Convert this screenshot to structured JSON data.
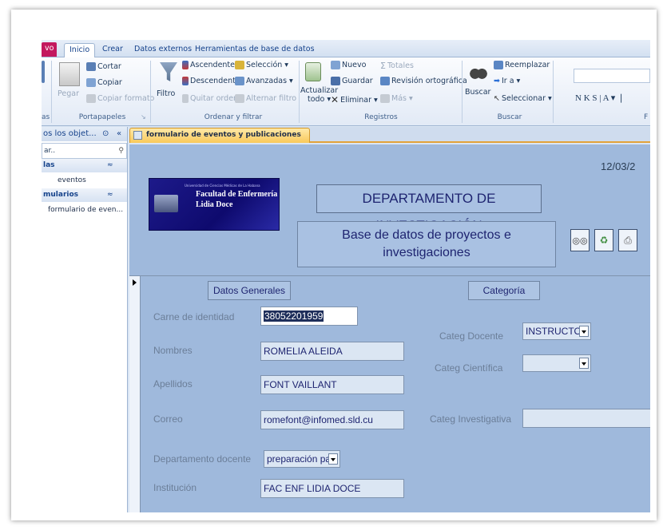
{
  "ribbon": {
    "tabs": [
      "vo",
      "Inicio",
      "Crear",
      "Datos externos",
      "Herramientas de base de datos"
    ],
    "portapapeles": {
      "label": "Portapapeles",
      "cortar": "Cortar",
      "copiar": "Copiar",
      "pegar": "Pegar",
      "copiar_formato": "Copiar formato"
    },
    "ordenar": {
      "label": "Ordenar y filtrar",
      "filtro": "Filtro",
      "ascendente": "Ascendente",
      "descendente": "Descendente",
      "quitar_orden": "Quitar orden",
      "seleccion": "Selección ▾",
      "avanzadas": "Avanzadas ▾",
      "alternar_filtro": "Alternar filtro"
    },
    "registros": {
      "label": "Registros",
      "actualizar": "Actualizar",
      "todo": "todo ▾",
      "nuevo": "Nuevo",
      "guardar": "Guardar",
      "eliminar": "Eliminar ▾",
      "totales": "Totales",
      "revision": "Revisión ortográfica",
      "mas": "Más ▾"
    },
    "buscar": {
      "label": "Buscar",
      "buscar": "Buscar",
      "reemplazar": "Reemplazar",
      "ir_a": "Ir a ▾",
      "seleccionar": "Seleccionar ▾"
    },
    "fmt": {
      "text": "N  K  S  |  A ▾  ❘",
      "label_f": "F"
    },
    "left_label": "as"
  },
  "nav": {
    "header": "os los objet...",
    "search_text": "ar..",
    "cat_tables": "las",
    "item_eventos": "eventos",
    "cat_forms": "mularios",
    "item_form": "formulario de even..."
  },
  "doctab": {
    "label": "formulario de eventos y publicaciones"
  },
  "form": {
    "date": "12/03/2",
    "logo": {
      "small": "Universidad de Ciencias Médicas de La Habana",
      "line1": "Facultad de Enfermería",
      "line2": "Lidia Doce"
    },
    "title": "DEPARTAMENTO DE INVESTIGACIÓN",
    "subtitle_1": "Base de datos de proyectos e",
    "subtitle_2": "investigaciones",
    "section_general": "Datos Generales",
    "section_categoria": "Categoría",
    "labels": {
      "carne": "Carne de identidad",
      "nombres": "Nombres",
      "apellidos": "Apellidos",
      "correo": "Correo",
      "departamento": "Departamento docente",
      "institucion": "Institución",
      "categ_docente": "Categ Docente",
      "categ_cientifica": "Categ Científica",
      "categ_investigativa": "Categ Investigativa"
    },
    "values": {
      "carne": "38052201959",
      "nombres": "ROMELIA ALEIDA",
      "apellidos": "FONT VAILLANT",
      "correo": "romefont@infomed.sld.cu",
      "departamento": "preparación pa",
      "institucion": "FAC ENF LIDIA DOCE",
      "categ_docente": "INSTRUCTOR",
      "categ_cientifica": "",
      "categ_investigativa": ""
    }
  },
  "colors": {
    "archivo_tab": "#c3185e",
    "form_bg": "#9fb9dc",
    "doc_tab": "#f9c95a"
  }
}
